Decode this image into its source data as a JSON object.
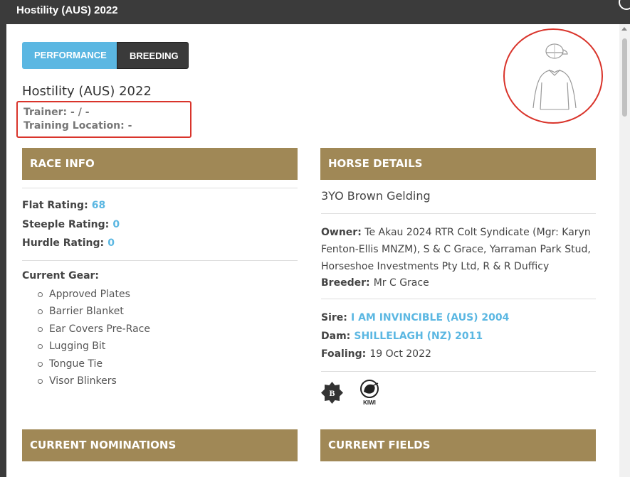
{
  "window": {
    "title": "Hostility (AUS) 2022"
  },
  "tabs": [
    {
      "label": "PERFORMANCE",
      "active": true
    },
    {
      "label": "BREEDING",
      "active": false
    }
  ],
  "horse": {
    "title": "Hostility (AUS) 2022",
    "trainer_label": "Trainer:",
    "trainer_value": "- / -",
    "location_label": "Training Location:",
    "location_value": "-"
  },
  "race_info": {
    "heading": "RACE INFO",
    "ratings": [
      {
        "label": "Flat Rating:",
        "value": "68"
      },
      {
        "label": "Steeple Rating:",
        "value": "0"
      },
      {
        "label": "Hurdle Rating:",
        "value": "0"
      }
    ],
    "gear_label": "Current Gear:",
    "gear": [
      "Approved Plates",
      "Barrier Blanket",
      "Ear Covers Pre-Race",
      "Lugging Bit",
      "Tongue Tie",
      "Visor Blinkers"
    ]
  },
  "horse_details": {
    "heading": "HORSE DETAILS",
    "summary": "3YO Brown Gelding",
    "owner_label": "Owner:",
    "owner_value": "Te Akau 2024 RTR Colt Syndicate (Mgr: Karyn Fenton-Ellis MNZM), S & C Grace, Yarraman Park Stud, Horseshoe Investments Pty Ltd, R & R Dufficy",
    "breeder_label": "Breeder:",
    "breeder_value": "Mr C Grace",
    "sire_label": "Sire:",
    "sire_value": "I AM INVINCIBLE (AUS) 2004",
    "dam_label": "Dam:",
    "dam_value": "SHILLELAGH (NZ) 2011",
    "foaling_label": "Foaling:",
    "foaling_value": "19 Oct 2022",
    "badges": {
      "b_letter": "B",
      "kiwi_text": "KIWI"
    }
  },
  "bottom_sections": {
    "nominations": "CURRENT NOMINATIONS",
    "fields": "CURRENT FIELDS"
  },
  "colors": {
    "accent": "#5bb7e2",
    "section": "#a08856",
    "highlight": "#d9342b"
  }
}
